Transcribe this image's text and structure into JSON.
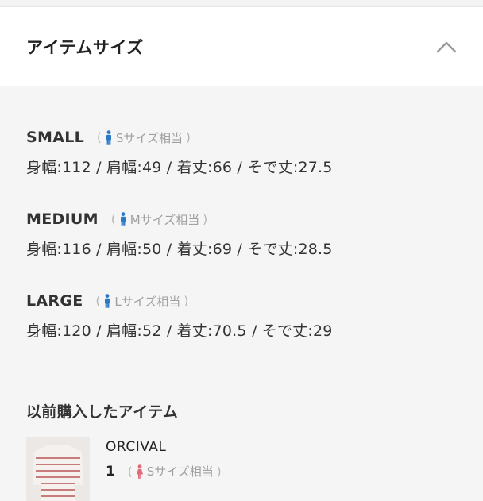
{
  "header": {
    "title": "アイテムサイズ",
    "toggle_icon": "chevron-up-icon"
  },
  "colors": {
    "male_icon": "#2b78c4",
    "female_icon": "#e06a7a",
    "stripe": "#c87c7c"
  },
  "sizes": [
    {
      "name": "SMALL",
      "equiv": "Sサイズ相当",
      "measurements": "身幅:112 / 肩幅:49 / 着丈:66 / そで丈:27.5"
    },
    {
      "name": "MEDIUM",
      "equiv": "Mサイズ相当",
      "measurements": "身幅:116 / 肩幅:50 / 着丈:69 / そで丈:28.5"
    },
    {
      "name": "LARGE",
      "equiv": "Lサイズ相当",
      "measurements": "身幅:120 / 肩幅:52 / 着丈:70.5 / そで丈:29"
    }
  ],
  "paren_open": "(",
  "paren_close": ")",
  "previous": {
    "title": "以前購入したアイテム",
    "items": [
      {
        "brand": "ORCIVAL",
        "size": "1",
        "equiv": "Sサイズ相当"
      }
    ]
  }
}
